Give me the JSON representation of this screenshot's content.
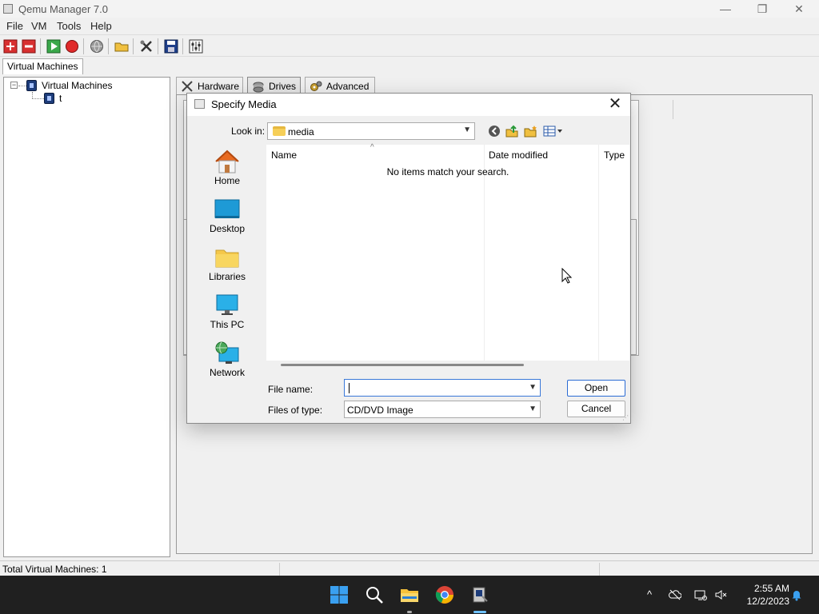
{
  "app": {
    "title": "Qemu Manager 7.0",
    "window_controls": {
      "minimize": "—",
      "maximize": "❐",
      "close": "✕"
    }
  },
  "menu": [
    "File",
    "VM",
    "Tools",
    "Help"
  ],
  "toolbar_icons": [
    "add-vm-icon",
    "remove-vm-icon",
    "start-icon",
    "stop-icon",
    "globe-icon",
    "open-folder-icon",
    "tools-icon",
    "save-icon",
    "settings-icon"
  ],
  "left_tab": "Virtual Machines",
  "tree": {
    "root": "Virtual Machines",
    "child": "t"
  },
  "right_tabs": [
    "Hardware",
    "Drives",
    "Advanced"
  ],
  "status": {
    "text": "Total Virtual Machines: 1"
  },
  "dialog": {
    "title": "Specify Media",
    "close": "✕",
    "look_in_label": "Look in:",
    "look_in_value": "media",
    "places": [
      "Home",
      "Desktop",
      "Libraries",
      "This PC",
      "Network"
    ],
    "columns": [
      "Name",
      "Date modified",
      "Type"
    ],
    "sort_caret": "^",
    "empty_message": "No items match your search.",
    "file_name_label": "File name:",
    "file_name_value": "",
    "files_of_type_label": "Files of type:",
    "files_of_type_value": "CD/DVD Image",
    "open_label": "Open",
    "cancel_label": "Cancel"
  },
  "taskbar": {
    "apps": [
      "windows-start-icon",
      "search-icon",
      "file-explorer-icon",
      "chrome-icon",
      "qemu-manager-icon"
    ],
    "tray": [
      "chevron-up-icon",
      "onedrive-icon",
      "display-icon",
      "speaker-muted-icon",
      "notification-bell-icon"
    ],
    "time": "2:55 AM",
    "date": "12/2/2023"
  }
}
